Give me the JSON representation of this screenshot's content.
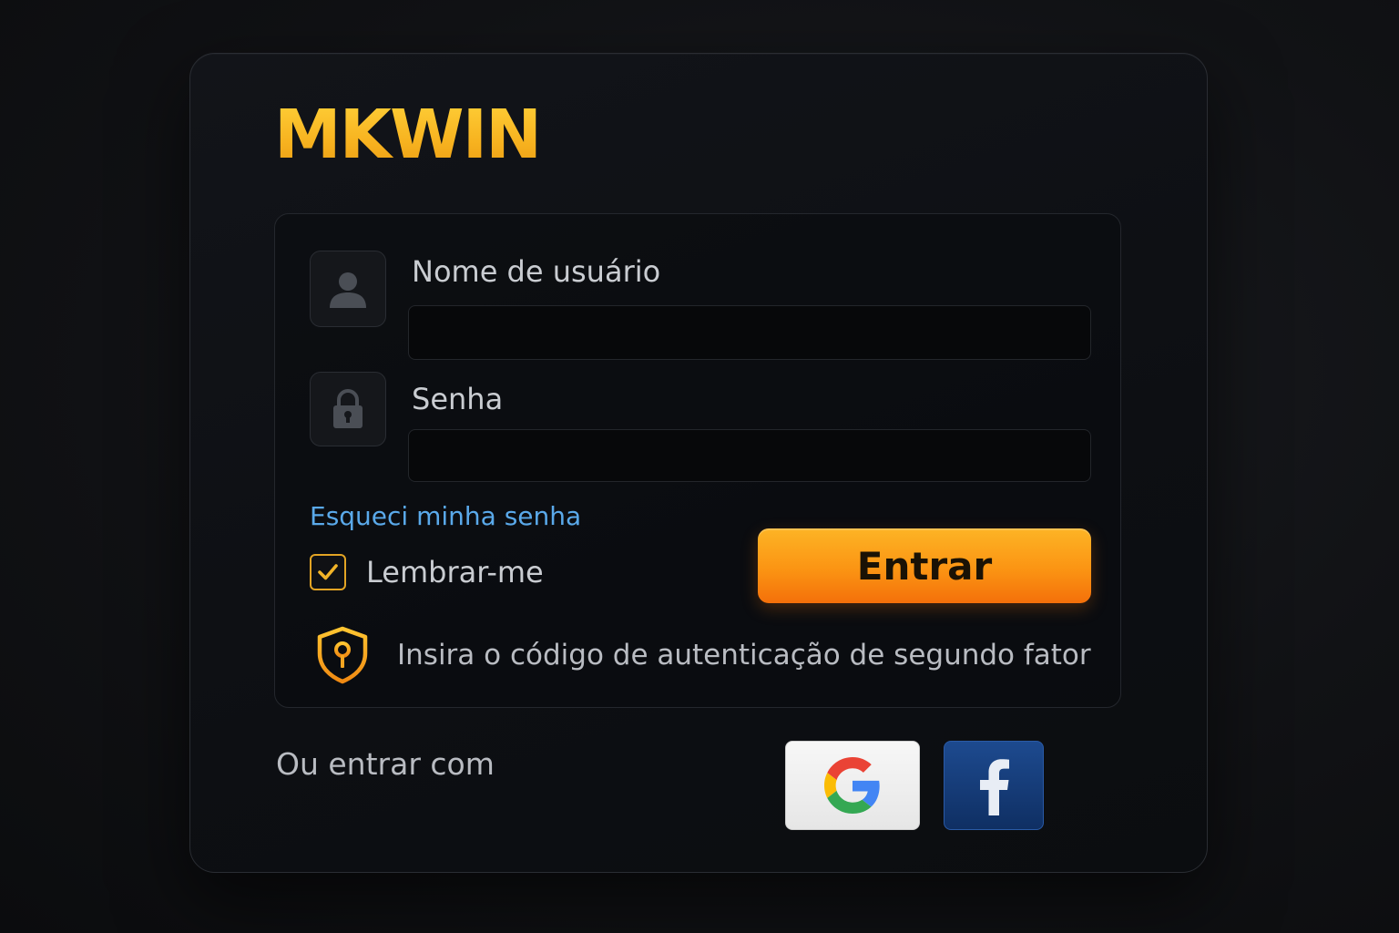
{
  "brand": {
    "name": "MKWIN"
  },
  "form": {
    "username_label": "Nome de usuário",
    "username_value": "",
    "password_label": "Senha",
    "password_value": "",
    "forgot_link": "Esqueci minha senha",
    "remember_label": "Lembrar-me",
    "remember_checked": true,
    "submit_label": "Entrar",
    "twofa_text": "Insira o código de autenticação de segundo fator"
  },
  "social": {
    "label": "Ou entrar com",
    "google_icon": "google-icon",
    "facebook_icon": "facebook-icon"
  },
  "colors": {
    "accent": "#f7b21f",
    "button": "#fb9413",
    "link": "#5aa9ea",
    "facebook": "#153c78"
  }
}
